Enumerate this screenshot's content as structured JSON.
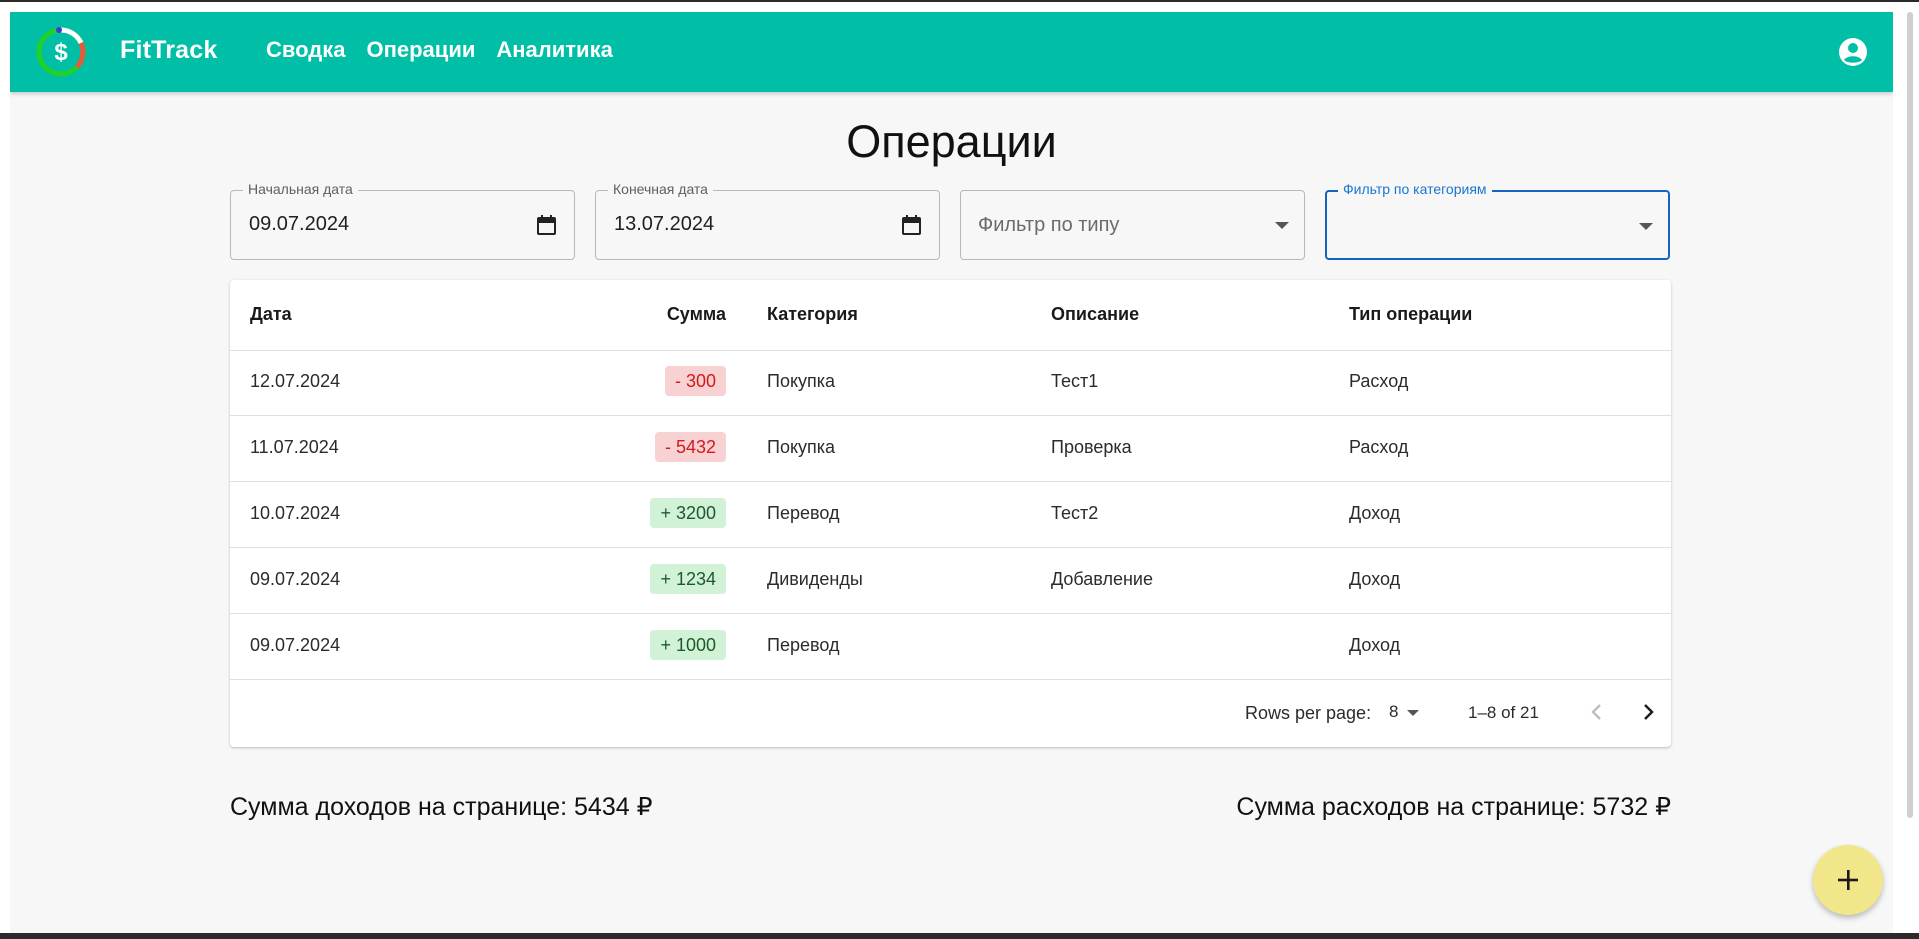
{
  "app": {
    "brand": "FitTrack",
    "nav": [
      "Сводка",
      "Операции",
      "Аналитика"
    ],
    "colors": {
      "appbar": "#00bfa6",
      "negative_bg": "#f8d2d2",
      "negative_text": "#d11a1a",
      "positive_bg": "#d2f2d8",
      "fab": "#f2e68a",
      "focus": "#1565c0"
    }
  },
  "page": {
    "title": "Операции"
  },
  "filters": {
    "start_date": {
      "label": "Начальная дата",
      "value": "09.07.2024"
    },
    "end_date": {
      "label": "Конечная дата",
      "value": "13.07.2024"
    },
    "type": {
      "placeholder": "Фильтр по типу"
    },
    "category": {
      "label": "Фильтр по категориям",
      "value": ""
    }
  },
  "table": {
    "headers": [
      "Дата",
      "Сумма",
      "Категория",
      "Описание",
      "Тип операции"
    ],
    "rows": [
      {
        "date": "12.07.2024",
        "amount": "- 300",
        "sign": "neg",
        "category": "Покупка",
        "description": "Тест1",
        "type": "Расход"
      },
      {
        "date": "11.07.2024",
        "amount": "- 5432",
        "sign": "neg",
        "category": "Покупка",
        "description": "Проверка",
        "type": "Расход"
      },
      {
        "date": "10.07.2024",
        "amount": "+ 3200",
        "sign": "pos",
        "category": "Перевод",
        "description": "Тест2",
        "type": "Доход"
      },
      {
        "date": "09.07.2024",
        "amount": "+ 1234",
        "sign": "pos",
        "category": "Дивиденды",
        "description": "Добавление",
        "type": "Доход"
      },
      {
        "date": "09.07.2024",
        "amount": "+ 1000",
        "sign": "pos",
        "category": "Перевод",
        "description": "",
        "type": "Доход"
      }
    ],
    "pagination": {
      "rows_per_page_label": "Rows per page:",
      "rows_per_page": "8",
      "range": "1–8 of 21"
    }
  },
  "totals": {
    "income": "Сумма доходов на странице: 5434 ₽",
    "expense": "Сумма расходов на странице: 5732 ₽"
  },
  "icons": {
    "logo": "dollar-ring-logo",
    "account": "account-circle-icon",
    "calendar": "calendar-icon",
    "add": "plus-icon"
  }
}
